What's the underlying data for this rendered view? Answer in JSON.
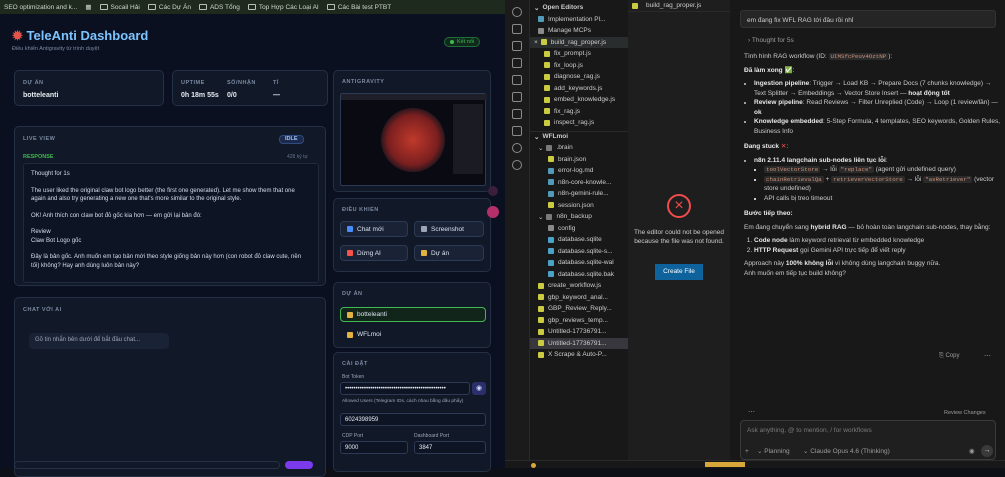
{
  "bookmarks": [
    "SEO optimization and k...",
    "Socail Hải",
    "Các Dự Án",
    "ADS Tổng",
    "Top Hợp Các Loại AI",
    "Các Bài test PTBT"
  ],
  "app": {
    "title": "TeleAnti Dashboard",
    "subtitle": "Điều khiển Antigravity từ trình duyệt",
    "connected": "Kết nối",
    "project_label": "Dự án",
    "project_value": "botteleanti",
    "uptime_label": "Uptime",
    "uptime_value": "0h 18m 55s",
    "success_label": "Số/Nhận",
    "success_value": "0/0",
    "ti_label": "Tỉ",
    "ti_value": "—",
    "live_label": "Live View",
    "idle": "IDLE",
    "response_label": "Response",
    "char_count": "428 ký tự",
    "response_lines": [
      "Thought for 1s",
      "The user liked the original claw bot logo better (the first one generated). Let me show them that one again and also try generating a new one that's more similar to the original style.",
      "OK! Anh thích con claw bot đỏ gốc kia hơn — em gửi lại bản đó:",
      "Review",
      "Claw Bot Logo gốc",
      "Đây là bản gốc. Anh muốn em tạo bản mới theo style giống bản này hơn (con robot đỏ claw cute, nền tối) không? Hay anh dùng luôn bản này?"
    ],
    "antigravity_label": "Antigravity",
    "control_label": "Điều khiển",
    "controls": [
      "Chat mới",
      "Screenshot",
      "Dừng AI",
      "Dự án"
    ],
    "chat_label": "Chat với AI",
    "chat_placeholder": "Gõ tin nhắn bên dưới để bắt đầu chat...",
    "projects_label": "Dự án",
    "projects": [
      "botteleanti",
      "WFLmoi"
    ],
    "settings_label": "Cài đặt",
    "bot_token_label": "Bot Token",
    "bot_token_value": "••••••••••••••••••••••••••••••••••••••••••••••••",
    "allowed_label": "Allowed Users (Telegram IDs, cách nhau bằng dấu phẩy)",
    "allowed_value": "6024398959",
    "cdp_label": "CDP Port",
    "cdp_value": "9000",
    "dash_label": "Dashboard Port",
    "dash_value": "3847"
  },
  "explorer": {
    "open_editors": "Open Editors",
    "open_files": [
      "Implementation Pl...",
      "Manage MCPs",
      "build_rag_proper.js"
    ],
    "files": [
      "fix_prompt.js",
      "fix_loop.js",
      "diagnose_rag.js",
      "add_keywords.js",
      "embed_knowledge.js",
      "fix_rag.js",
      "inspect_rag.js"
    ],
    "section": "WFLmoi",
    "tree": [
      ".brain",
      "brain.json",
      "error-log.md",
      "n8n-core-knowle...",
      "n8n-gemini-rule...",
      "session.json",
      "n8n_backup",
      "config",
      "database.sqlite",
      "database.sqlite-s...",
      "database.sqlite-wal",
      "database.sqlite.bak",
      "create_workflow.js",
      "gbp_keyword_anal...",
      "GBP_Review_Reply...",
      "gbp_reviews_temp...",
      "Untitled-17736791...",
      "Untitled-17736791...",
      "X Scrape & Auto-P..."
    ]
  },
  "editor": {
    "tab": "build_rag_proper.js",
    "error": "The editor could not be opened because the file was not found.",
    "create": "Create File"
  },
  "chat": {
    "user_msg": "em đang fix WFL RAG tới đâu rồi nhỉ",
    "thought": "Thought for 5s",
    "review": "Review Changes",
    "copy": "Copy",
    "input_placeholder": "Ask anything, @ to mention, / for workflows",
    "mode": "Planning",
    "model": "Claude Opus 4.6 (Thinking)"
  },
  "colors": {
    "accent": "#6ea8fe",
    "ok": "#3fb950",
    "danger": "#f85149",
    "purple": "#7c3aed"
  }
}
